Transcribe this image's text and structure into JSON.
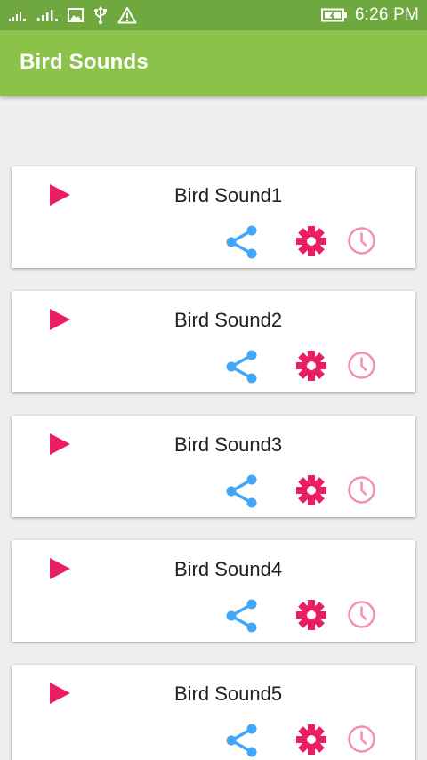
{
  "status_bar": {
    "time": "6:26 PM",
    "icons": [
      "signal-1-icon",
      "signal-2-icon",
      "image-icon",
      "usb-icon",
      "warning-icon",
      "battery-icon"
    ]
  },
  "app_bar": {
    "title": "Bird Sounds"
  },
  "colors": {
    "status_bar": "#6ea83f",
    "app_bar": "#8bc34a",
    "play": "#e91e63",
    "share": "#42a5f5",
    "settings": "#e91e63",
    "timer": "#f48fb1"
  },
  "sounds": [
    {
      "title": "Bird Sound1"
    },
    {
      "title": "Bird Sound2"
    },
    {
      "title": "Bird Sound3"
    },
    {
      "title": "Bird Sound4"
    },
    {
      "title": "Bird Sound5"
    }
  ]
}
